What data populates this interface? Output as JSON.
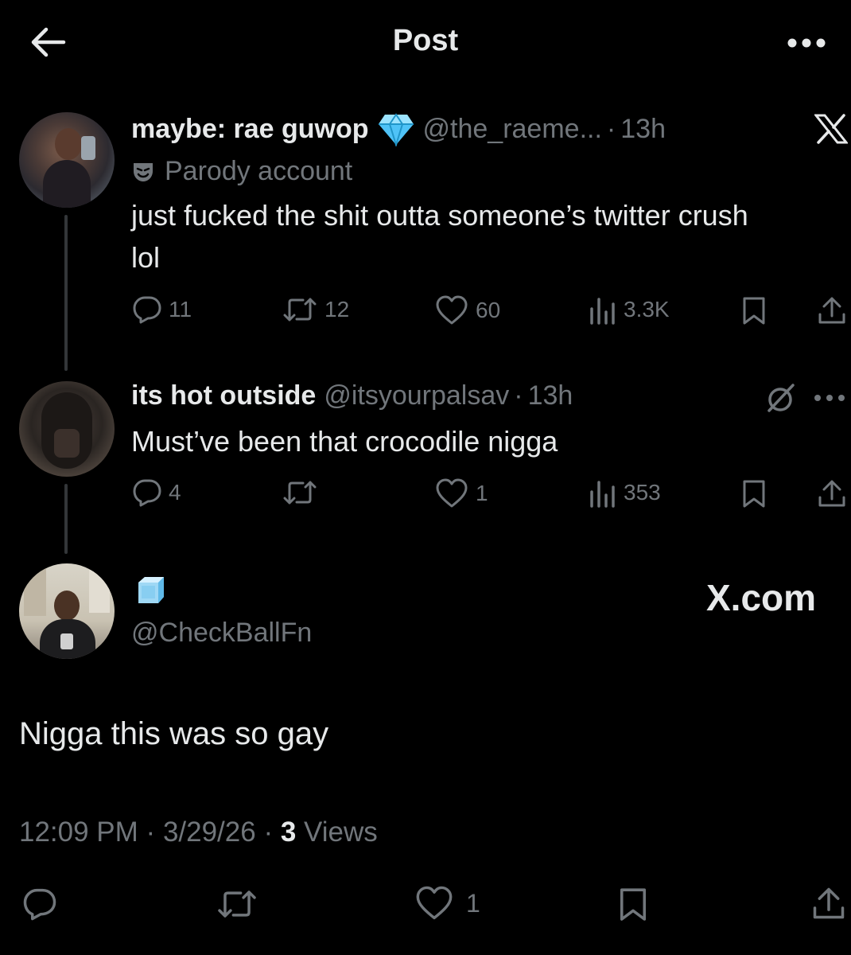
{
  "header": {
    "title": "Post"
  },
  "brand": {
    "watermark": "X.com"
  },
  "tweets": [
    {
      "display_name": "maybe: rae guwop",
      "handle": "@the_raeme...",
      "time": "13h",
      "parody_label": "Parody account",
      "text": "just fucked the shit outta someone’s twitter crush lol",
      "stats": {
        "replies": "11",
        "reposts": "12",
        "likes": "60",
        "views": "3.3K"
      }
    },
    {
      "display_name": "its hot outside",
      "handle": "@itsyourpalsav",
      "time": "13h",
      "text": "Must’ve been that crocodile nigga",
      "stats": {
        "replies": "4",
        "reposts": "",
        "likes": "1",
        "views": "353"
      }
    }
  ],
  "main_tweet": {
    "handle": "@CheckBallFn",
    "text": "Nigga this was so gay",
    "time": "12:09 PM",
    "date": "3/29/26",
    "views_count": "3",
    "views_label": "Views",
    "likes": "1"
  },
  "colors": {
    "background": "#000000",
    "text": "#e7e9ea",
    "muted": "#71767b",
    "verified_badge": "#4fc3f7"
  },
  "icons": [
    "back-arrow-icon",
    "more-icon",
    "x-logo-icon",
    "diamond-emoji-icon",
    "parody-mask-icon",
    "reply-icon",
    "repost-icon",
    "like-icon",
    "views-icon",
    "bookmark-icon",
    "share-icon",
    "grok-icon",
    "ice-cube-emoji-icon"
  ]
}
